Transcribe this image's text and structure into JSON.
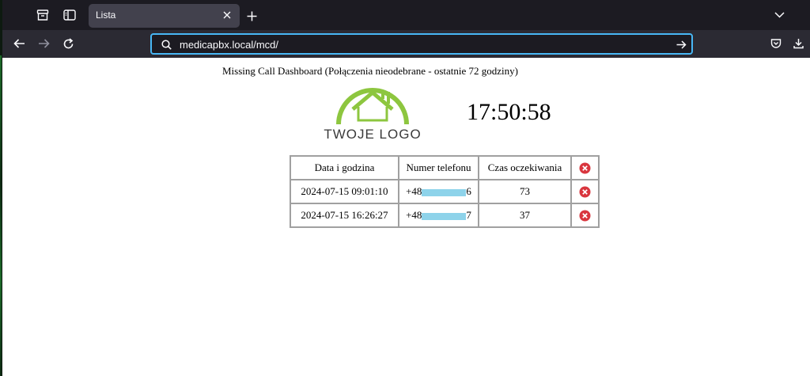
{
  "browser": {
    "tab_title": "Lista",
    "url": "medicapbx.local/mcd/"
  },
  "page": {
    "title": "Missing Call Dashboard (Połączenia nieodebrane - ostatnie 72 godziny)",
    "logo_text": "TWOJE LOGO",
    "clock": "17:50:58"
  },
  "table": {
    "headers": [
      "Data i godzina",
      "Numer telefonu",
      "Czas oczekiwania"
    ],
    "rows": [
      {
        "datetime": "2024-07-15 09:01:10",
        "phone_prefix": "+48",
        "phone_suffix": "6",
        "wait": "73"
      },
      {
        "datetime": "2024-07-15 16:26:27",
        "phone_prefix": "+48",
        "phone_suffix": "7",
        "wait": "37"
      }
    ]
  },
  "colors": {
    "accent": "#48b7f5",
    "logo_green": "#8dc63f",
    "delete_red": "#d9363e",
    "redaction": "#8ed3ea"
  }
}
